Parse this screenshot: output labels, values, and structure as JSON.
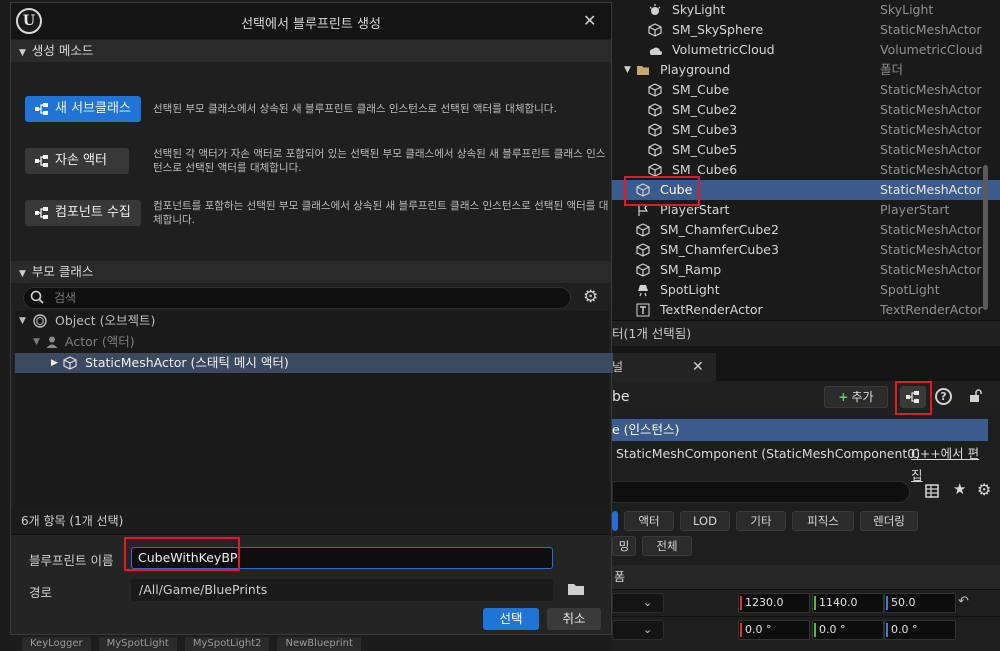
{
  "dialog": {
    "title": "선택에서 블루프린트 생성",
    "section_methods": "생성 메소드",
    "methods": [
      {
        "label": "새 서브클래스",
        "desc": "선택된 부모 클래스에서 상속된 새 블루프린트 클래스 인스턴스로 선택된 액터를 대체합니다."
      },
      {
        "label": "자손 액터",
        "desc": "선택된 각 액터가 자손 액터로 포함되어 있는 선택된 부모 클래스에서 상속된 새 블루프린트 클래스 인스턴스로 선택된 액터를 대체합니다."
      },
      {
        "label": "컴포넌트 수집",
        "desc": "컴포넌트를 포함하는 선택된 부모 클래스에서 상속된 새 블루프린트 클래스 인스턴스로 선택된 액터를 대체합니다."
      }
    ],
    "section_parent": "부모 클래스",
    "search_placeholder": "검색",
    "tree": [
      {
        "label": "Object (오브젝트)"
      },
      {
        "label": "Actor (액터)"
      },
      {
        "label": "StaticMeshActor (스태틱 메시 액터)"
      }
    ],
    "count": "6개 항목 (1개 선택)",
    "name_label": "블루프린트 이름",
    "name_value": "CubeWithKeyBP",
    "path_label": "경로",
    "path_value": "/All/Game/BluePrints",
    "ok": "선택",
    "cancel": "취소"
  },
  "outliner": {
    "rows": [
      {
        "name": "SkyLight",
        "type": "SkyLight"
      },
      {
        "name": "SM_SkySphere",
        "type": "StaticMeshActor"
      },
      {
        "name": "VolumetricCloud",
        "type": "VolumetricCloud"
      },
      {
        "name": "Playground",
        "type": "폴더"
      },
      {
        "name": "SM_Cube",
        "type": "StaticMeshActor"
      },
      {
        "name": "SM_Cube2",
        "type": "StaticMeshActor"
      },
      {
        "name": "SM_Cube3",
        "type": "StaticMeshActor"
      },
      {
        "name": "SM_Cube5",
        "type": "StaticMeshActor"
      },
      {
        "name": "SM_Cube6",
        "type": "StaticMeshActor"
      },
      {
        "name": "Cube",
        "type": "StaticMeshActor"
      },
      {
        "name": "PlayerStart",
        "type": "PlayerStart"
      },
      {
        "name": "SM_ChamferCube2",
        "type": "StaticMeshActor"
      },
      {
        "name": "SM_ChamferCube3",
        "type": "StaticMeshActor"
      },
      {
        "name": "SM_Ramp",
        "type": "StaticMeshActor"
      },
      {
        "name": "SpotLight",
        "type": "SpotLight"
      },
      {
        "name": "TextRenderActor",
        "type": "TextRenderActor"
      }
    ],
    "status": "터(1개 선택됨)"
  },
  "details": {
    "tab_label": "널",
    "title": "be",
    "add_label": "추가",
    "component_root": "e (인스턴스)",
    "component_child": "StaticMeshComponent (StaticMeshComponent0)",
    "component_edit": "C++에서 편집",
    "filters_row1": [
      "",
      "액터",
      "LOD",
      "기타",
      "피직스",
      "렌더링"
    ],
    "filters_row2": [
      "밍",
      "전체"
    ],
    "section_label": "폼",
    "location": [
      "1230.0",
      "1140.0",
      "50.0"
    ],
    "rotation": [
      "0.0 °",
      "0.0 °",
      "0.0 °"
    ]
  },
  "bottom_tabs": [
    "KeyLogger",
    "MySpotLight",
    "MySpotLight2",
    "NewBlueprint"
  ],
  "colors": {
    "accent": "#1f74d6",
    "selection": "#3a5b8c",
    "highlight": "#e11b22"
  }
}
